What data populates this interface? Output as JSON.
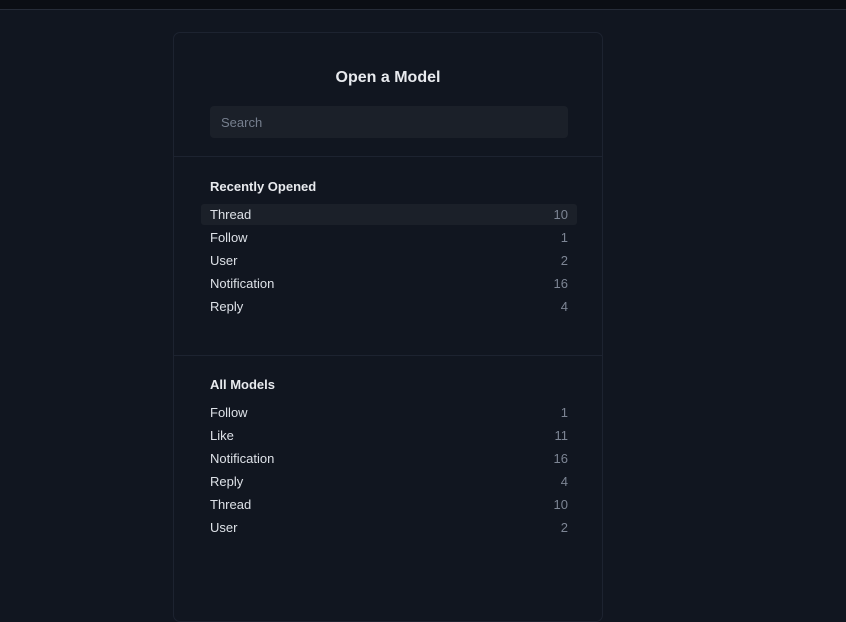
{
  "dialog": {
    "title": "Open a Model",
    "search_placeholder": "Search",
    "search_value": ""
  },
  "recent": {
    "title": "Recently Opened",
    "items": [
      {
        "name": "Thread",
        "count": "10",
        "active": true
      },
      {
        "name": "Follow",
        "count": "1"
      },
      {
        "name": "User",
        "count": "2"
      },
      {
        "name": "Notification",
        "count": "16"
      },
      {
        "name": "Reply",
        "count": "4"
      }
    ]
  },
  "all_models": {
    "title": "All Models",
    "items": [
      {
        "name": "Follow",
        "count": "1"
      },
      {
        "name": "Like",
        "count": "11"
      },
      {
        "name": "Notification",
        "count": "16"
      },
      {
        "name": "Reply",
        "count": "4"
      },
      {
        "name": "Thread",
        "count": "10"
      },
      {
        "name": "User",
        "count": "2"
      }
    ]
  }
}
